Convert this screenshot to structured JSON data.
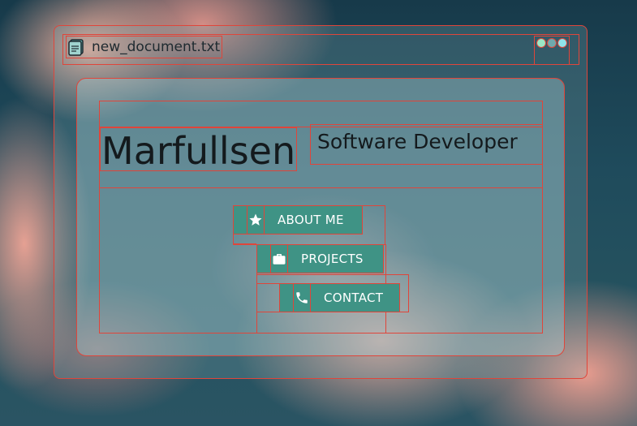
{
  "window": {
    "title": "new_document.txt",
    "file_icon": "notebook-icon",
    "controls": [
      {
        "name": "minimize-dot",
        "color": "#9be8c6"
      },
      {
        "name": "maximize-dot",
        "color": "#b2e2e6"
      },
      {
        "name": "close-dot",
        "color": "#8fe4ea"
      }
    ]
  },
  "profile": {
    "name": "Marfullsen",
    "role": "Software Developer"
  },
  "nav": {
    "about": {
      "label": "ABOUT ME",
      "icon": "star-icon"
    },
    "projects": {
      "label": "PROJECTS",
      "icon": "briefcase-icon"
    },
    "contact": {
      "label": "CONTACT",
      "icon": "phone-icon"
    }
  },
  "colors": {
    "accent": "#3f9385",
    "outline": "#e0453a"
  }
}
